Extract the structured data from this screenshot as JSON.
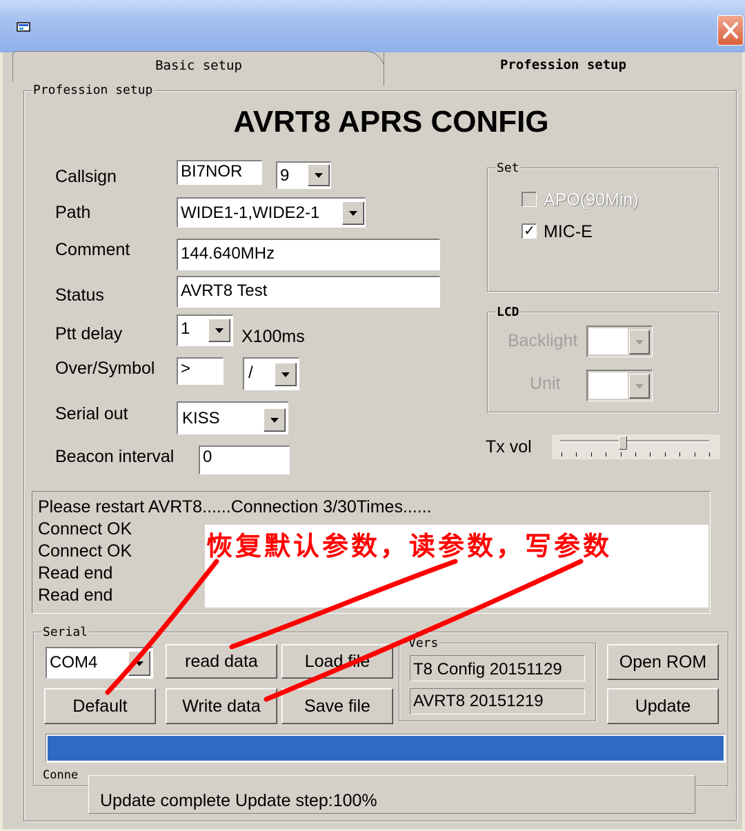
{
  "tabs": {
    "basic": "Basic setup",
    "profession": "Profession setup"
  },
  "group_title": "Profession setup",
  "heading": "AVRT8 APRS CONFIG",
  "form": {
    "callsign_label": "Callsign",
    "callsign_value": "BI7NOR",
    "ssid_value": "9",
    "path_label": "Path",
    "path_value": "WIDE1-1,WIDE2-1",
    "comment_label": "Comment",
    "comment_value": "144.640MHz",
    "status_label": "Status",
    "status_value": "AVRT8 Test",
    "ptt_label": "Ptt delay",
    "ptt_value": "1",
    "ptt_unit": "X100ms",
    "symbol_label": "Over/Symbol",
    "overlay_value": ">",
    "symbol_value": "/",
    "serial_out_label": "Serial out",
    "serial_out_value": "KISS",
    "beacon_label": "Beacon interval",
    "beacon_value": "0"
  },
  "set_group": {
    "title": "Set",
    "apo_label": "APO(90Min)",
    "apo_checked": false,
    "mice_label": "MIC-E",
    "mice_checked": true,
    "check_mark": "✓"
  },
  "lcd_group": {
    "title": "LCD",
    "backlight_label": "Backlight",
    "unit_label": "Unit"
  },
  "txvol": {
    "label": "Tx vol",
    "level": 0.42
  },
  "log": {
    "lines": [
      "Please restart AVRT8......Connection 3/30Times......",
      "Connect OK",
      "Connect OK",
      "Read end",
      "Read end"
    ],
    "annotation": "恢复默认参数，读参数，写参数"
  },
  "serial_group": {
    "title": "Serial",
    "port_value": "COM4",
    "read_label": "read data",
    "load_label": "Load file",
    "default_label": "Default",
    "write_label": "Write data",
    "save_label": "Save file"
  },
  "vers_group": {
    "title": "Vers",
    "config_version": "T8 Config 20151129",
    "fw_version": "AVRT8 20151219"
  },
  "rom": {
    "open_label": "Open ROM",
    "update_label": "Update"
  },
  "progress": {
    "percent": 100,
    "color": "#316ac5"
  },
  "connect_group": {
    "title": "Conne"
  },
  "status_bar": {
    "text": "Update complete Update step:100%"
  },
  "colors": {
    "annotation_red": "#ff0000",
    "titlebar_blue": "#a4c0ef",
    "close_red": "#d9603b"
  }
}
